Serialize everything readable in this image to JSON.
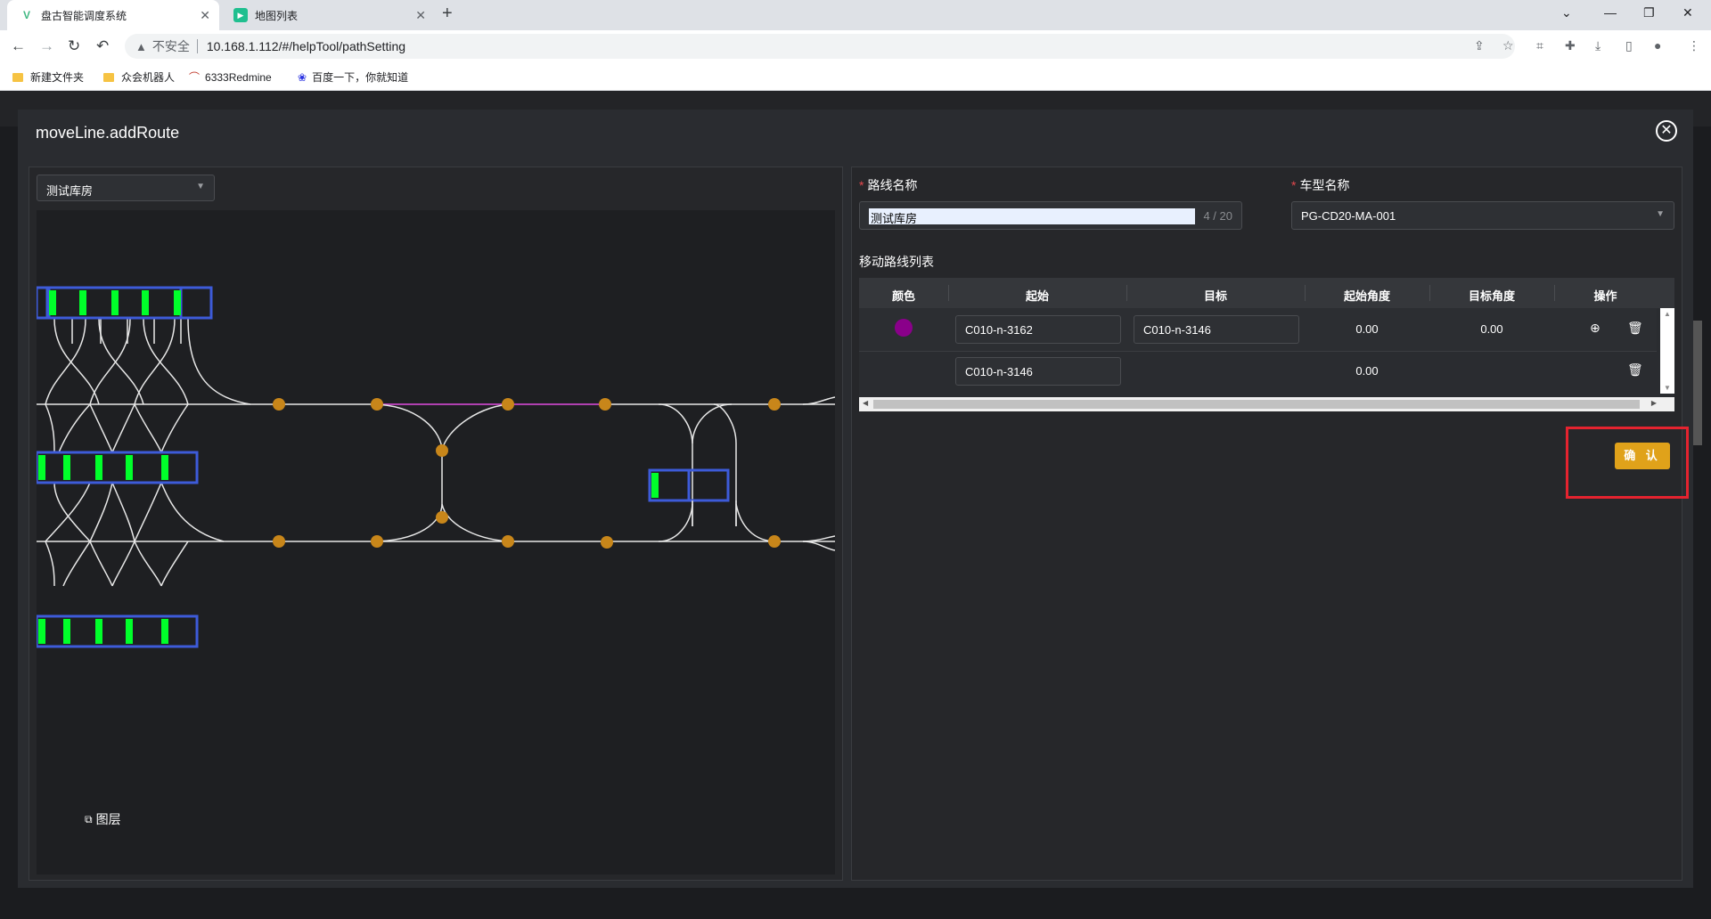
{
  "browser": {
    "tabs": [
      {
        "title": "盘古智能调度系统",
        "active": true
      },
      {
        "title": "地图列表",
        "active": false
      }
    ],
    "address": {
      "security": "不安全",
      "url": "10.168.1.112/#/helpTool/pathSetting"
    },
    "bookmarks": [
      {
        "label": "新建文件夹",
        "icon": "folder-icon"
      },
      {
        "label": "众会机器人",
        "icon": "folder-icon"
      },
      {
        "label": "6333Redmine",
        "icon": "redmine-icon"
      },
      {
        "label": "百度一下，你就知道",
        "icon": "baidu-icon"
      }
    ]
  },
  "modal": {
    "title": "moveLine.addRoute",
    "map": {
      "selected_map": "测试库房",
      "layers_label": "图层"
    },
    "form": {
      "route_name_label": "路线名称",
      "route_name_value": "测试库房",
      "route_name_count": "4 / 20",
      "vehicle_type_label": "车型名称",
      "vehicle_type_value": "PG-CD20-MA-001",
      "route_list_label": "移动路线列表",
      "table": {
        "headers": [
          "颜色",
          "起始",
          "目标",
          "起始角度",
          "目标角度",
          "操作"
        ],
        "rows": [
          {
            "color": "#8a008a",
            "start": "C010-n-3162",
            "target": "C010-n-3146",
            "start_angle": "0.00",
            "target_angle": "0.00"
          },
          {
            "color": "",
            "start": "C010-n-3146",
            "target": "",
            "start_angle": "0.00",
            "target_angle": ""
          }
        ]
      },
      "confirm_label": "确 认"
    }
  }
}
